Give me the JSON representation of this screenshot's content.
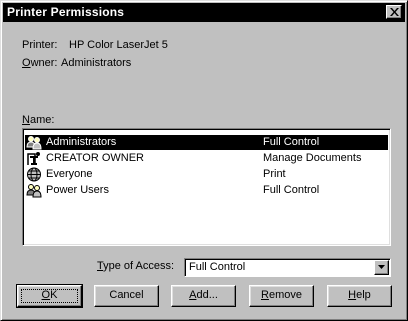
{
  "window": {
    "title": "Printer Permissions"
  },
  "printer": {
    "label": "Printer:",
    "value": "HP Color LaserJet 5"
  },
  "owner": {
    "label_u": "O",
    "label_rest": "wner:",
    "value": "Administrators"
  },
  "name_label": {
    "u": "N",
    "rest": "ame:"
  },
  "entries": [
    {
      "name": "Administrators",
      "access": "Full Control",
      "icon": "group-icon",
      "selected": true
    },
    {
      "name": "CREATOR OWNER",
      "access": "Manage Documents",
      "icon": "creator-owner-icon",
      "selected": false
    },
    {
      "name": "Everyone",
      "access": "Print",
      "icon": "globe-icon",
      "selected": false
    },
    {
      "name": "Power Users",
      "access": "Full Control",
      "icon": "group-icon",
      "selected": false
    }
  ],
  "access": {
    "label_u": "T",
    "label_rest": "ype of Access:",
    "value": "Full Control"
  },
  "buttons": {
    "ok": {
      "u": "O",
      "rest": "K"
    },
    "cancel": "Cancel",
    "add": {
      "u": "A",
      "rest": "dd..."
    },
    "remove": {
      "u": "R",
      "rest": "emove"
    },
    "help": {
      "u": "H",
      "rest": "elp"
    }
  },
  "colors": {
    "selection": "#000000",
    "face": "#c0c0c0",
    "title_bar": "#000000"
  }
}
